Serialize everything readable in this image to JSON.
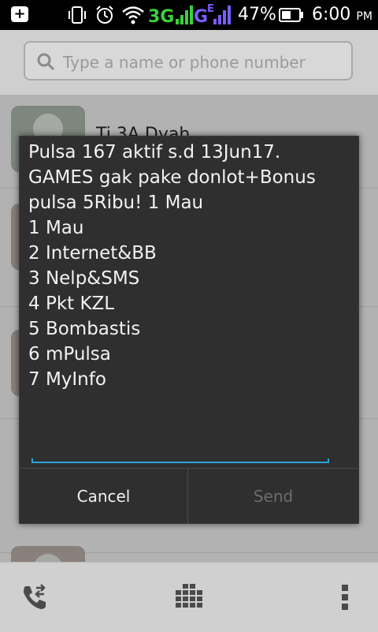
{
  "status_bar": {
    "network_3g": "3G",
    "network_e": "G",
    "network_e_sub": "E",
    "battery_percent": "47%",
    "time": "6:00",
    "ampm": "PM",
    "colors": {
      "three_g": "#3bd13b",
      "e_net": "#7a5cff"
    },
    "icons": [
      "notification-icon",
      "vibrate-icon",
      "alarm-icon",
      "wifi-icon",
      "signal-icon",
      "battery-icon"
    ]
  },
  "search": {
    "placeholder": "Type a name or phone number",
    "icon": "search-icon"
  },
  "contacts": [
    {
      "name": "Ti 3A Dyah"
    }
  ],
  "dialog": {
    "message_lines": [
      "Pulsa 167 aktif s.d 13Jun17.",
      "GAMES gak pake donlot+Bonus",
      "pulsa 5Ribu! 1 Mau",
      "1 Mau",
      "2 Internet&BB",
      "3 Nelp&SMS",
      "4 Pkt KZL",
      "5 Bombastis",
      "6 mPulsa",
      "7 MyInfo"
    ],
    "reply_value": "",
    "cancel_label": "Cancel",
    "send_label": "Send",
    "accent_color": "#2ca3d8"
  },
  "bottom_bar": {
    "icons": [
      "call-log-icon",
      "dialpad-icon",
      "overflow-menu-icon"
    ]
  }
}
